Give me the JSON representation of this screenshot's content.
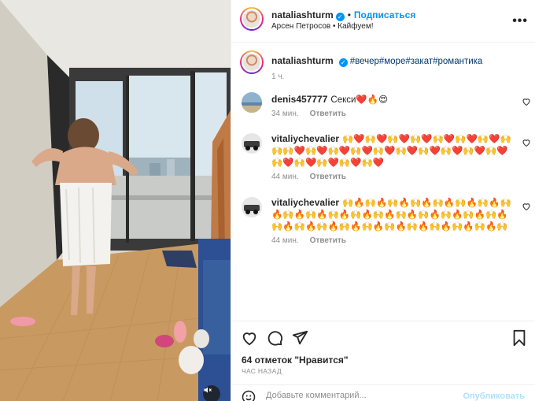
{
  "post": {
    "author": "nataliashturm",
    "follow_label": "Подписаться",
    "audio": "Арсен Петросов",
    "location": "Кайфуем!",
    "bullet": "•",
    "caption_hashtags": "#вечер#море#закат#романтика",
    "posted_ago": "1 ч."
  },
  "comments": [
    {
      "username": "denis457777",
      "text": "Секси❤️🔥😍",
      "time": "34 мин.",
      "reply_label": "Ответить"
    },
    {
      "username": "vitaliychevalier",
      "text": "🙌❤️🙌❤️🙌❤️🙌❤️🙌❤️🙌❤️🙌❤️🙌🙌🙌❤️🙌❤️🙌❤️🙌❤️🙌❤️🙌❤️🙌❤️🙌❤️🙌❤️🙌❤️🙌❤️🙌❤️🙌❤️🙌❤️🙌❤️",
      "time": "44 мин.",
      "reply_label": "Ответить"
    },
    {
      "username": "vitaliychevalier",
      "text": "🙌🔥🙌🔥🙌🔥🙌🔥🙌🔥🙌🔥🙌🔥🙌🔥🙌🔥🙌🔥🙌🔥🙌🔥🙌🔥🙌🔥🙌🔥🙌🔥🙌🔥🙌🔥🙌🔥🙌🔥🙌🔥🙌🔥🙌🔥🙌🔥🙌🔥🙌🔥🙌🔥🙌🔥🙌",
      "time": "44 мин.",
      "reply_label": "Ответить"
    }
  ],
  "footer": {
    "likes": "64 отметок \"Нравится\"",
    "ago": "ЧАС НАЗАД",
    "comment_placeholder": "Добавьте комментарий...",
    "publish_label": "Опубликовать"
  },
  "icons": {
    "more": "more-options-icon",
    "like": "heart-icon",
    "comment": "comment-icon",
    "share": "share-icon",
    "save": "bookmark-icon",
    "emoji": "emoji-icon",
    "mute": "muted-speaker-icon",
    "verified": "verified-badge-icon"
  },
  "colors": {
    "link_blue": "#0095f6",
    "hashtag": "#00376b",
    "muted_text": "#8e8e8e",
    "publish_disabled": "#b2dffc"
  }
}
